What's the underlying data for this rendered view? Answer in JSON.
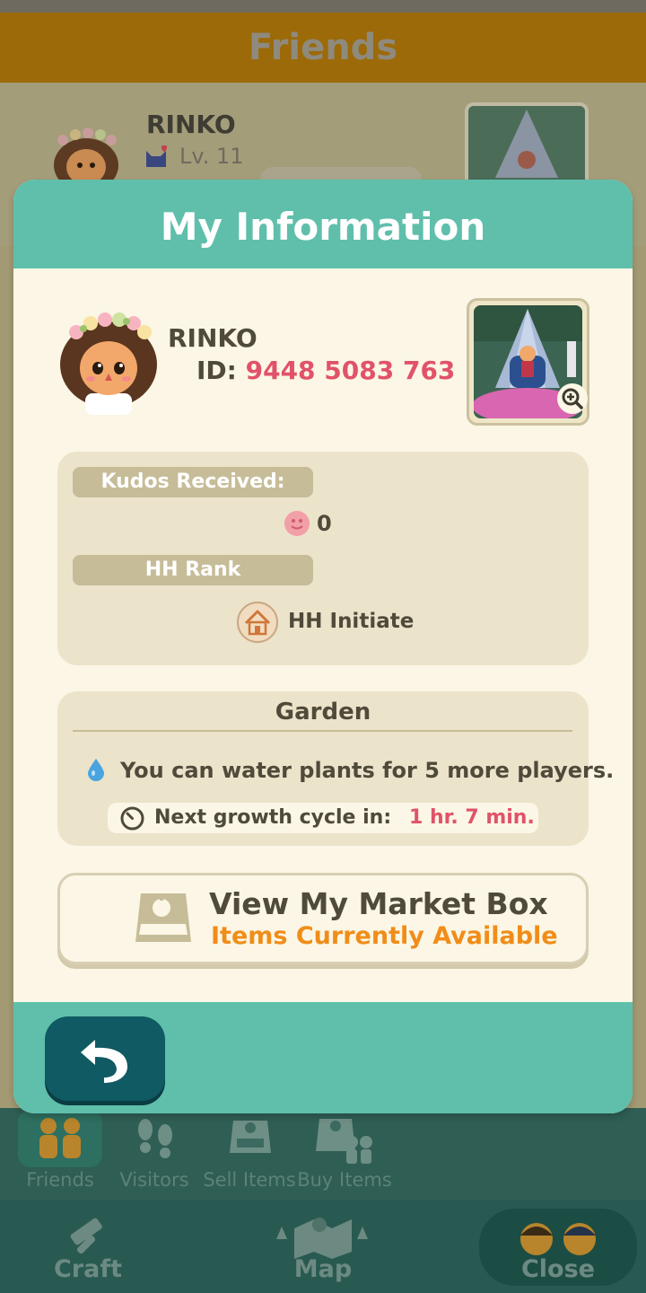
{
  "background": {
    "header_title": "Friends",
    "friend": {
      "name": "RINKO",
      "level": "Lv. 11"
    },
    "tabs": [
      {
        "label": "Friends",
        "icon": "friends-icon",
        "active": true
      },
      {
        "label": "Visitors",
        "icon": "footprints-icon",
        "active": false
      },
      {
        "label": "Sell Items",
        "icon": "market-box-icon",
        "active": false
      },
      {
        "label": "Buy Items",
        "icon": "buy-items-icon",
        "active": false
      }
    ],
    "bottom_nav": {
      "craft": "Craft",
      "map": "Map",
      "close": "Close"
    }
  },
  "modal": {
    "title": "My Information",
    "player": {
      "name": "RINKO",
      "id_label": "ID:",
      "id_value": "9448 5083 763"
    },
    "kudos": {
      "label": "Kudos Received:",
      "value": "0"
    },
    "hh_rank": {
      "label": "HH Rank",
      "value": "HH Initiate"
    },
    "garden": {
      "title": "Garden",
      "water_text": "You can water plants for 5 more players.",
      "growth_label": "Next growth cycle in:",
      "growth_value": "1 hr. 7 min."
    },
    "market_box": {
      "title": "View My Market Box",
      "subtitle": "Items Currently Available"
    }
  },
  "colors": {
    "teal": "#5fbfab",
    "cream": "#fbf6e5",
    "panel": "#ece3cb",
    "accent_pink": "#e15269",
    "accent_orange": "#f08d19",
    "back_button": "#0f5a63"
  }
}
